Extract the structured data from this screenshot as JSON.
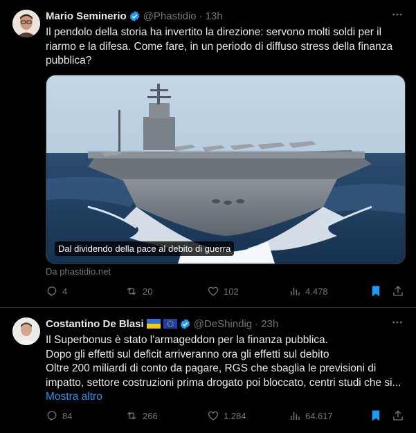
{
  "tweets": [
    {
      "author": "Mario Seminerio",
      "handle": "@Phastidio",
      "time": "13h",
      "text_lines": [
        "Il pendolo della storia ha invertito la direzione: servono molti soldi per il",
        "riarmo e la difesa. Come fare, in un periodo di diffuso stress della finanza",
        "pubblica?"
      ],
      "card_caption": "Dal dividendo della pace al debito di guerra",
      "card_source": "Da phastidio.net",
      "replies": "4",
      "reposts": "20",
      "likes": "102",
      "views": "4.478"
    },
    {
      "author": "Costantino De Blasi",
      "handle": "@DeShindig",
      "time": "23h",
      "text_lines": [
        "Il Superbonus è stato l'armageddon per la finanza pubblica.",
        "Dopo gli effetti sul deficit arriveranno ora gli effetti sul debito",
        "Oltre 200 miliardi di conto da pagare, RGS che sbaglia le previsioni di",
        "impatto, settore costruzioni prima drogato poi bloccato, centri studi che si..."
      ],
      "show_more": "Mostra altro",
      "replies": "84",
      "reposts": "266",
      "likes": "1.284",
      "views": "64.617"
    }
  ],
  "icons": {
    "verified": "verified-badge-icon",
    "more": "more-options-icon",
    "reply": "reply-icon",
    "repost": "repost-icon",
    "like": "like-icon",
    "views": "views-icon",
    "bookmark": "bookmark-icon",
    "share": "share-icon",
    "flags": [
      "ukraine-flag-icon",
      "eu-flag-icon"
    ]
  },
  "colors": {
    "background": "#000000",
    "text": "#e7e9ea",
    "secondary": "#71767b",
    "accent": "#1d9bf0",
    "divider": "#2f3336"
  }
}
